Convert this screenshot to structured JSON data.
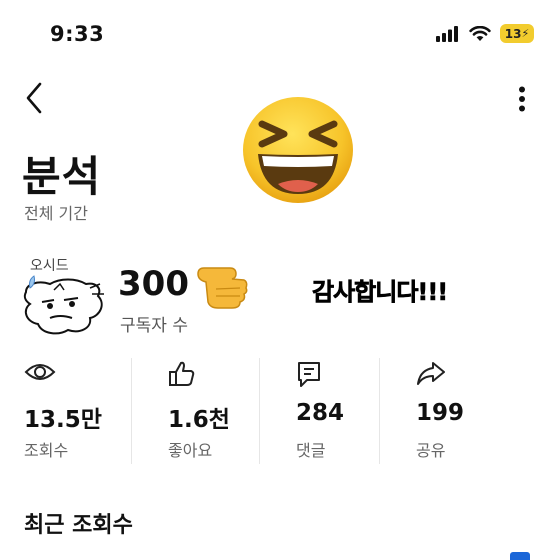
{
  "status_bar": {
    "time": "9:33",
    "battery": "13",
    "icons": [
      "cellular-signal-icon",
      "wifi-icon",
      "battery-icon"
    ]
  },
  "header": {
    "back_icon": "chevron-left-icon",
    "more_icon": "more-vertical-icon"
  },
  "page": {
    "title": "분석",
    "period": "전체 기간"
  },
  "overlay": {
    "emoji": "laughing-face-emoji",
    "pointer": "pointing-hand-emoji",
    "thanks_text": "감사합니다!!!",
    "doodle_text": "오시드"
  },
  "subscribers": {
    "count": "300",
    "label": "구독자 수"
  },
  "stats": [
    {
      "icon": "eye-icon",
      "value": "13.5만",
      "label": "조회수"
    },
    {
      "icon": "thumbs-up-icon",
      "value": "1.6천",
      "label": "좋아요"
    },
    {
      "icon": "comment-icon",
      "value": "284",
      "label": "댓글"
    },
    {
      "icon": "share-icon",
      "value": "199",
      "label": "공유"
    }
  ],
  "recent": {
    "title": "최근 조회수"
  },
  "colors": {
    "battery": "#f2cc2e",
    "emoji": "#f6c328",
    "accent": "#1b66d8"
  }
}
